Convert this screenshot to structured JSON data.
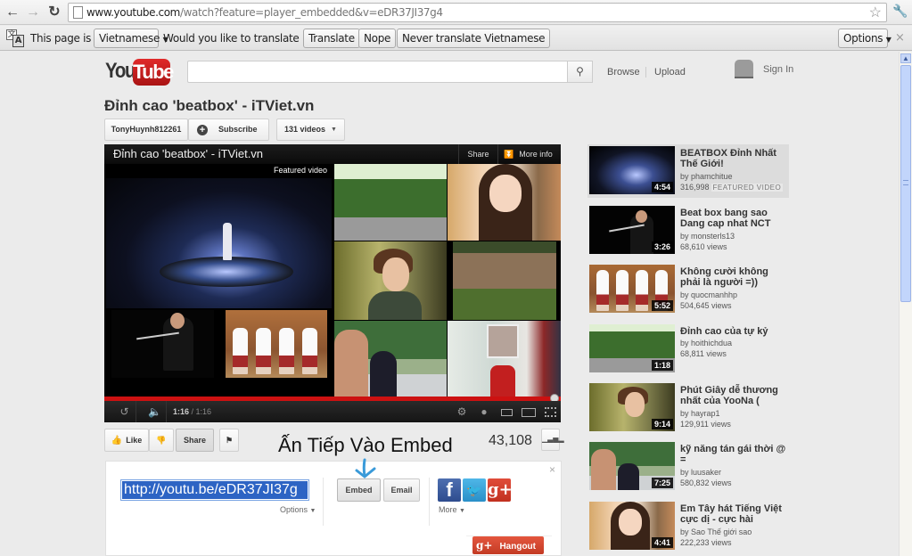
{
  "browser": {
    "url_host": "www.youtube.com",
    "url_path": "/watch?feature=player_embedded&v=eDR37JI37g4",
    "icons": {
      "back": "back-arrow-icon",
      "forward": "forward-arrow-icon",
      "reload": "reload-icon",
      "page": "page-icon",
      "bookmark": "star-icon",
      "menu": "wrench-icon"
    }
  },
  "translate_bar": {
    "prefix": "This page is in",
    "language": "Vietnamese",
    "question": "Would you like to translate it?",
    "translate_label": "Translate",
    "nope_label": "Nope",
    "never_label": "Never translate Vietnamese",
    "options_label": "Options",
    "close_symbol": "×"
  },
  "header": {
    "logo_you": "You",
    "logo_tube": "Tube",
    "search_placeholder": "",
    "search_icon": "🔍",
    "browse": "Browse",
    "upload": "Upload",
    "sign_in": "Sign In"
  },
  "video": {
    "title": "Đỉnh cao 'beatbox' - iTViet.vn",
    "channel": "TonyHuynh812261",
    "subscribe": "Subscribe",
    "videos_count": "131 videos",
    "view_count": "43,108"
  },
  "player": {
    "title": "Đỉnh cao 'beatbox' - iTViet.vn",
    "share": "Share",
    "more_info": "More info",
    "featured_label": "Featured video",
    "time_current": "1:16",
    "time_sep": " / ",
    "time_total": "1:16",
    "progress_fraction": 1.0
  },
  "actions": {
    "like": "Like",
    "share": "Share",
    "annotation": "Ấn Tiếp Vào Embed"
  },
  "share_panel": {
    "short_url": "http://youtu.be/eDR37JI37g",
    "options": "Options",
    "embed": "Embed",
    "email": "Email",
    "more": "More",
    "hangout": "Hangout",
    "close_symbol": "×"
  },
  "related": [
    {
      "title": "BEATBOX Đỉnh Nhất Thế Giới!",
      "by": "by phamchitue",
      "views": "316,998",
      "badge": "FEATURED VIDEO",
      "duration": "4:54",
      "active": true
    },
    {
      "title": "Beat box bang sao Dang cap nhat NCT",
      "by": "by monsterls13",
      "views": "68,610 views",
      "duration": "3:26"
    },
    {
      "title": "Không cười không phải là người =))",
      "by": "by quocmanhhp",
      "views": "504,645 views",
      "duration": "5:52"
    },
    {
      "title": "Đỉnh cao của tự kỷ",
      "by": "by hoithichdua",
      "views": "68,811 views",
      "duration": "1:18"
    },
    {
      "title": "Phút Giây dễ thương nhất của YooNa (",
      "by": "by hayrap1",
      "views": "129,911 views",
      "duration": "9:14"
    },
    {
      "title": "kỹ năng tán gái thời @ =",
      "by": "by luusaker",
      "views": "580,832 views",
      "duration": "7:25"
    },
    {
      "title": "Em Tây hát Tiếng Việt cực dị - cực hài",
      "by": "by Sao Thế giới sao",
      "views": "222,233 views",
      "duration": "4:41"
    }
  ]
}
